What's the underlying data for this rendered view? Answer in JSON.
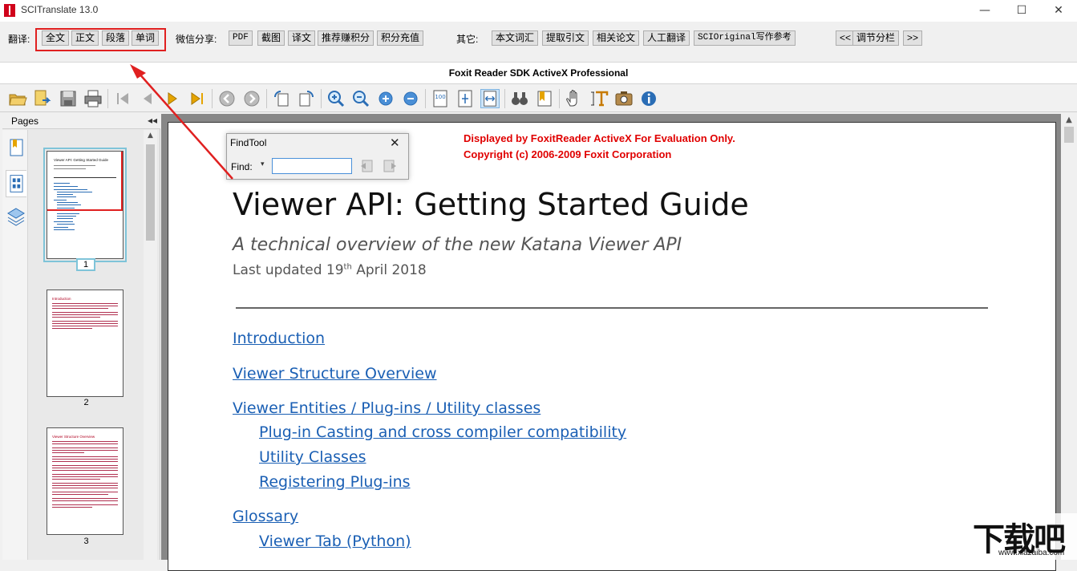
{
  "window": {
    "title": "SCITranslate 13.0",
    "minimize": "—",
    "maximize": "☐",
    "close": "✕"
  },
  "apptoolbar": {
    "translate_label": "翻译:",
    "translate_buttons": [
      "全文",
      "正文",
      "段落",
      "单词"
    ],
    "wechat_label": "微信分享:",
    "wechat_buttons": [
      "PDF",
      "截图",
      "译文",
      "推荐赚积分",
      "积分充值"
    ],
    "other_label": "其它:",
    "other_buttons": [
      "本文词汇",
      "提取引文",
      "相关论文",
      "人工翻译",
      "SCIOriginal写作参考"
    ],
    "split_prev": "<<",
    "split_label": "调节分栏",
    "split_next": ">>"
  },
  "foxit": {
    "title": "Foxit Reader SDK ActiveX Professional"
  },
  "pdftoolbar": {
    "icons": [
      "open-icon",
      "export-icon",
      "save-icon",
      "print-icon",
      "first-page-icon",
      "prev-page-icon",
      "next-page-icon",
      "last-page-icon",
      "back-icon",
      "forward-icon",
      "rotate-left-icon",
      "rotate-right-icon",
      "zoom-in-icon",
      "zoom-out-icon",
      "zoom-plus-icon",
      "zoom-minus-icon",
      "actual-size-icon",
      "fit-page-icon",
      "fit-width-icon",
      "find-icon",
      "bookmark-icon",
      "hand-icon",
      "select-text-icon",
      "snapshot-icon",
      "info-icon"
    ],
    "actual_size_text": "100"
  },
  "pages_panel": {
    "title": "Pages",
    "collapse": "◂◂",
    "thumbnails": [
      {
        "num": "1",
        "heading": "Viewer API: Getting Started Guide"
      },
      {
        "num": "2",
        "heading": "Introduction"
      },
      {
        "num": "3",
        "heading": "Viewer Structure Overview"
      }
    ]
  },
  "document": {
    "eval_line1": "Displayed by FoxitReader ActiveX For Evaluation Only.",
    "eval_line2": "Copyright (c) 2006-2009 Foxit Corporation",
    "title": "Viewer API: Getting Started Guide",
    "subtitle": "A technical overview of the new Katana Viewer API",
    "updated_prefix": "Last updated 19",
    "updated_sup": "th",
    "updated_suffix": " April 2018",
    "toc": [
      {
        "text": "Introduction",
        "level": 1
      },
      {
        "text": "Viewer Structure Overview",
        "level": 1
      },
      {
        "text": "Viewer Entities / Plug-ins / Utility classes",
        "level": 1
      },
      {
        "text": "Plug-in Casting and cross compiler compatibility",
        "level": 2
      },
      {
        "text": "Utility Classes",
        "level": 2
      },
      {
        "text": "Registering Plug-ins",
        "level": 2
      },
      {
        "text": "Glossary",
        "level": 1
      },
      {
        "text": "Viewer Tab (Python)",
        "level": 2
      }
    ]
  },
  "findtool": {
    "title": "FindTool",
    "close": "✕",
    "label": "Find:",
    "dropdown": "▾",
    "value": ""
  },
  "watermark": {
    "main": "下载吧",
    "sub": "www.xiazaiba.com"
  },
  "colors": {
    "accent_red": "#e02020",
    "link_blue": "#1a5fb4",
    "eval_red": "#e00000"
  }
}
